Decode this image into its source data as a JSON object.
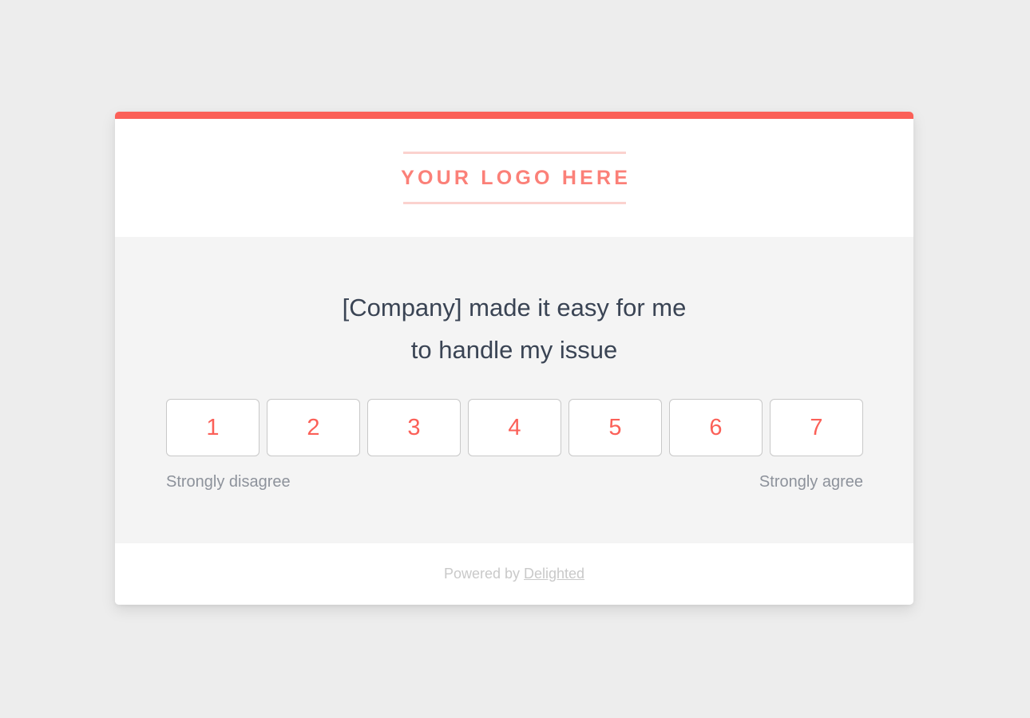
{
  "theme": {
    "page_background": "#ededed",
    "accent_color": "#fb6058",
    "card_background": "#ffffff",
    "body_background": "#f4f4f4",
    "question_text_color": "#3a4454",
    "scale_label_color": "#8d929b",
    "footer_text_color": "#c9c9c9",
    "logo_text_color": "#fb8078",
    "logo_rule_color": "#fbd2ce",
    "button_border_color": "#c8c8c8"
  },
  "header": {
    "logo_placeholder_text": "YOUR LOGO HERE"
  },
  "survey": {
    "question": "[Company] made it easy for me to handle my issue",
    "question_line_1": "[Company] made it easy for me",
    "question_line_2": "to handle my issue",
    "scale": {
      "options": [
        {
          "value": "1"
        },
        {
          "value": "2"
        },
        {
          "value": "3"
        },
        {
          "value": "4"
        },
        {
          "value": "5"
        },
        {
          "value": "6"
        },
        {
          "value": "7"
        }
      ],
      "low_label": "Strongly disagree",
      "high_label": "Strongly agree",
      "min": 1,
      "max": 7,
      "selected": null
    }
  },
  "footer": {
    "powered_by_text": "Powered by",
    "brand_link_text": "Delighted"
  }
}
